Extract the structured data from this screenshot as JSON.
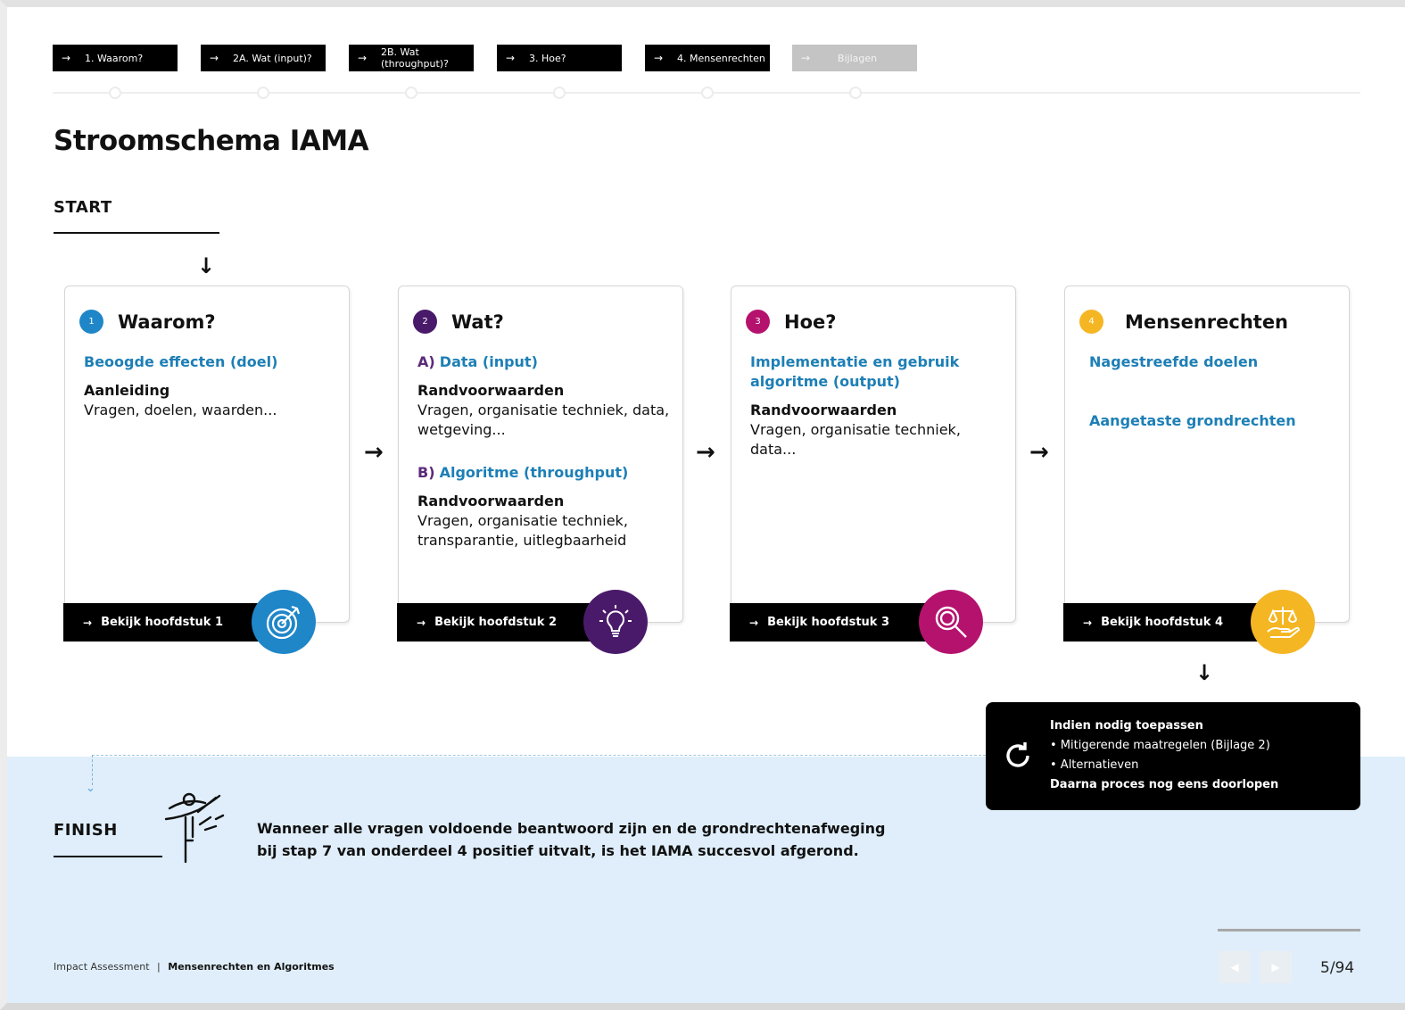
{
  "nav": {
    "tabs": [
      {
        "label": "1. Waarom?"
      },
      {
        "label": "2A. Wat (input)?"
      },
      {
        "label": "2B. Wat (throughput)?"
      },
      {
        "label": "3. Hoe?"
      },
      {
        "label": "4. Mensenrechten"
      },
      {
        "label": "Bijlagen"
      }
    ]
  },
  "page": {
    "title": "Stroomschema IAMA"
  },
  "start": {
    "label": "START"
  },
  "cards": [
    {
      "num": "1",
      "title": "Waarom?",
      "color": "#1f86c8",
      "link": "Beoogde effecten (doel)",
      "subhead": "Aanleiding",
      "text": "Vragen, doelen, waarden...",
      "foot": "Bekijk hoofdstuk 1",
      "icon": "target-icon"
    },
    {
      "num": "2",
      "title": "Wat?",
      "color": "#4a1a6a",
      "a_prefix": "A)",
      "a_link": "Data (input)",
      "a_subhead": "Randvoorwaarden",
      "a_text": "Vragen, organisatie techniek, data, wetgeving...",
      "b_prefix": "B)",
      "b_link": "Algoritme (throughput)",
      "b_subhead": "Randvoorwaarden",
      "b_text": "Vragen, organisatie techniek, transparantie, uitlegbaarheid",
      "foot": "Bekijk hoofdstuk 2",
      "icon": "lightbulb-icon"
    },
    {
      "num": "3",
      "title": "Hoe?",
      "color": "#b5126e",
      "link": "Implementatie en gebruik algoritme (output)",
      "subhead": "Randvoorwaarden",
      "text": "Vragen, organisatie techniek, data...",
      "foot": "Bekijk hoofdstuk 3",
      "icon": "magnifier-icon"
    },
    {
      "num": "4",
      "title": "Mensenrechten",
      "color": "#f5b623",
      "link1": "Nagestreefde doelen",
      "link2": "Aangetaste grondrechten",
      "foot": "Bekijk hoofdstuk 4",
      "icon": "scales-hand-icon"
    }
  ],
  "callout": {
    "title": "Indien nodig toepassen",
    "items": [
      "• Mitigerende maatregelen (Bijlage 2)",
      "• Alternatieven"
    ],
    "footer": "Daarna proces nog eens doorlopen",
    "icon": "refresh-icon"
  },
  "finish": {
    "label": "FINISH",
    "line1": "Wanneer alle vragen voldoende beantwoord zijn en de grondrechtenafweging",
    "line2": "bij stap 7 van onderdeel 4 positief uitvalt, is het IAMA succesvol afgerond."
  },
  "footer": {
    "doc_name": "Impact Assessment",
    "separator": "|",
    "doc_subtitle": "Mensenrechten en Algoritmes",
    "page": "5/94"
  }
}
